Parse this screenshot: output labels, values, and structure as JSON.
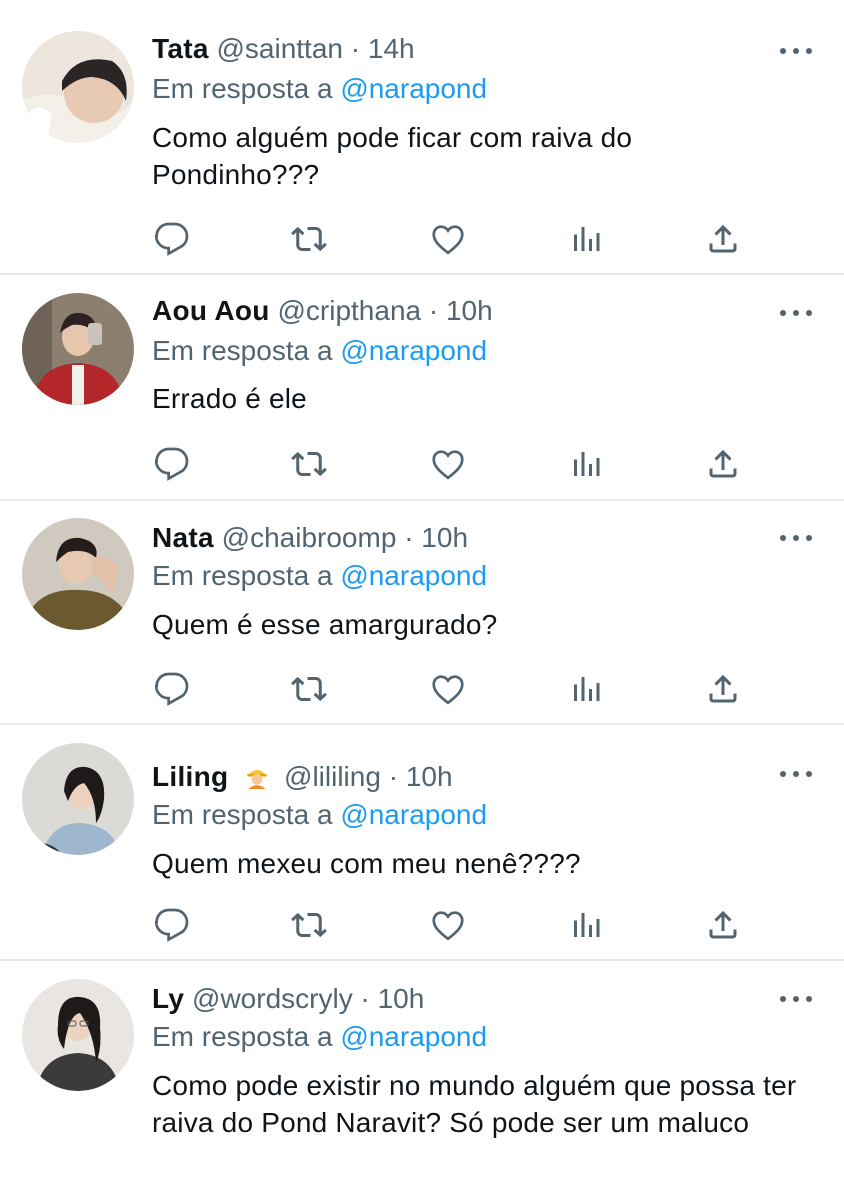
{
  "reply_prefix": "Em resposta a",
  "colors": {
    "mention": "#1d9bf0",
    "muted": "#536471",
    "text": "#0f1419",
    "divider": "#e7eaec"
  },
  "icons": {
    "more": "more-horizontal-icon",
    "reply": "reply-bubble-icon",
    "retweet": "retweet-icon",
    "like": "heart-icon",
    "views": "views-chart-icon",
    "share": "share-upload-icon"
  },
  "tweets": [
    {
      "name": "Tata",
      "handle": "@sainttan",
      "dot": "·",
      "time": "14h",
      "reply_to": "@narapond",
      "text": "Como alguém pode ficar com raiva do Pondinho???"
    },
    {
      "name": "Aou Aou",
      "handle": "@cripthana",
      "dot": "·",
      "time": "10h",
      "reply_to": "@narapond",
      "text": "Errado é ele"
    },
    {
      "name": "Nata",
      "handle": "@chaibroomp",
      "dot": "·",
      "time": "10h",
      "reply_to": "@narapond",
      "text": "Quem é esse amargurado?"
    },
    {
      "name": "Liling",
      "name_emoji": "construction-worker-emoji",
      "handle": "@lililing",
      "dot": "·",
      "time": "10h",
      "reply_to": "@narapond",
      "text": "Quem mexeu com meu nenê????"
    },
    {
      "name": "Ly",
      "handle": "@wordscryly",
      "dot": "·",
      "time": "10h",
      "reply_to": "@narapond",
      "text": "Como pode existir no mundo alguém que possa ter raiva do Pond Naravit? Só pode ser um maluco"
    }
  ]
}
